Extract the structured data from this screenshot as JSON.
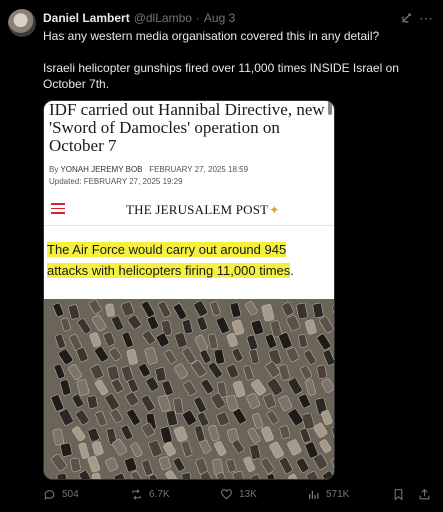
{
  "tweet": {
    "display_name": "Daniel Lambert",
    "handle": "@dlLambo",
    "separator": "·",
    "date": "Aug 3",
    "text_line1": "Has any western media organisation covered this in any detail?",
    "text_line2": "Israeli helicopter gunships fired over 11,000 times INSIDE Israel on October 7th."
  },
  "article": {
    "headline": "IDF carried out Hannibal Directive, new 'Sword of Damocles' operation on October 7",
    "by_prefix": "By",
    "author": "YONAH JEREMY BOB",
    "published": "FEBRUARY 27, 2025 18:59",
    "updated_label": "Updated:",
    "updated": "FEBRUARY 27, 2025 19:29",
    "publication": "THE JERUSALEM POST",
    "quote_line1": "The Air Force would carry out around 945",
    "quote_line2": "attacks with helicopters firing 11,000 times",
    "quote_end": "."
  },
  "actions": {
    "replies": "504",
    "reposts": "6.7K",
    "likes": "13K",
    "views": "571K"
  },
  "colors": {
    "background": "#000000",
    "text": "#e7e9ea",
    "muted": "#71767b",
    "highlight": "#f5f03f",
    "brand_red": "#d9232b"
  },
  "icons": [
    "grok-icon",
    "more-icon",
    "menu-icon",
    "reply-icon",
    "repost-icon",
    "like-icon",
    "views-icon",
    "bookmark-icon",
    "share-icon"
  ]
}
